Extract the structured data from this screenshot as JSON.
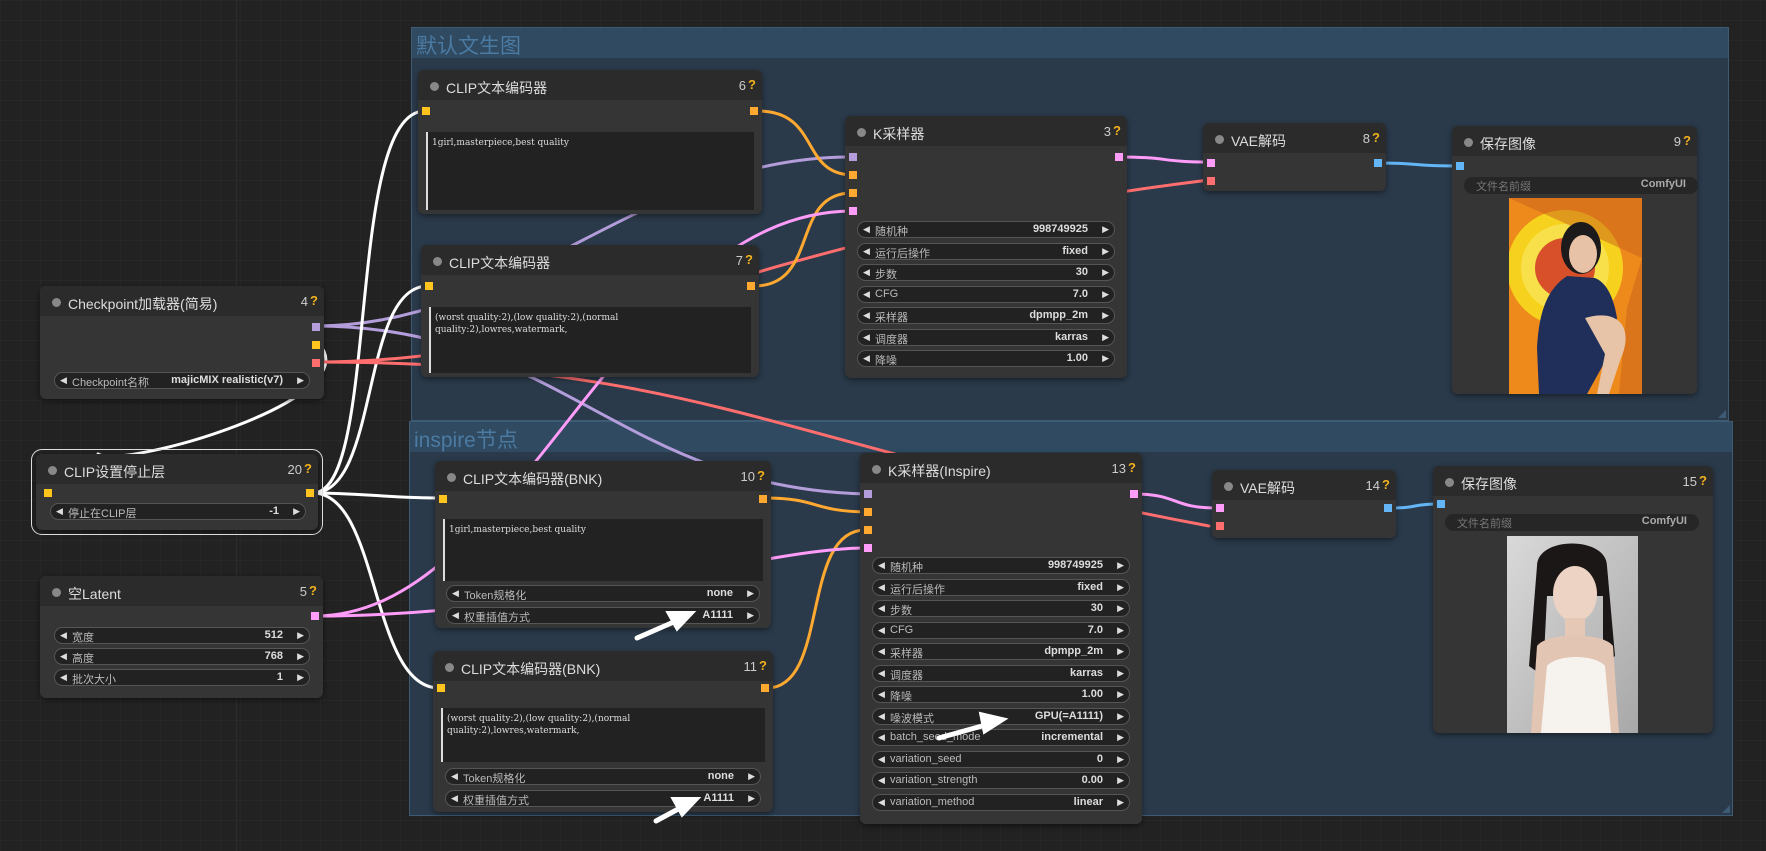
{
  "groups": {
    "default": {
      "title": "默认文生图"
    },
    "inspire": {
      "title": "inspire节点"
    }
  },
  "colors": {
    "model": "#b39ddb",
    "clip": "#ffc51e",
    "vae": "#ff6e6e",
    "conditioning": "#ffa931",
    "latent": "#ff9cf9",
    "image": "#64b5f6"
  },
  "nodes": {
    "ckpt": {
      "title": "Checkpoint加载器(简易)",
      "id": "4",
      "widgets": [
        {
          "label": "Checkpoint名称",
          "value": "majicMIX realistic(v7)"
        }
      ]
    },
    "clipstop": {
      "title": "CLIP设置停止层",
      "id": "20",
      "widgets": [
        {
          "label": "停止在CLIP层",
          "value": "-1"
        }
      ]
    },
    "latent": {
      "title": "空Latent",
      "id": "5",
      "widgets": [
        {
          "label": "宽度",
          "value": "512"
        },
        {
          "label": "高度",
          "value": "768"
        },
        {
          "label": "批次大小",
          "value": "1"
        }
      ]
    },
    "clip6": {
      "title": "CLIP文本编码器",
      "id": "6",
      "text": "1girl,masterpiece,best quality"
    },
    "clip7": {
      "title": "CLIP文本编码器",
      "id": "7",
      "text": "(worst quality:2),(low quality:2),(normal\nquality:2),lowres,watermark,"
    },
    "ksampler": {
      "title": "K采样器",
      "id": "3",
      "widgets": [
        {
          "label": "随机种",
          "value": "998749925"
        },
        {
          "label": "运行后操作",
          "value": "fixed"
        },
        {
          "label": "步数",
          "value": "30"
        },
        {
          "label": "CFG",
          "value": "7.0"
        },
        {
          "label": "采样器",
          "value": "dpmpp_2m"
        },
        {
          "label": "调度器",
          "value": "karras"
        },
        {
          "label": "降噪",
          "value": "1.00"
        }
      ]
    },
    "vae8": {
      "title": "VAE解码",
      "id": "8"
    },
    "save9": {
      "title": "保存图像",
      "id": "9",
      "prefix_label": "文件名前缀",
      "prefix_value": "ComfyUI"
    },
    "bnk10": {
      "title": "CLIP文本编码器(BNK)",
      "id": "10",
      "text": "1girl,masterpiece,best quality",
      "widgets": [
        {
          "label": "Token规格化",
          "value": "none"
        },
        {
          "label": "权重插值方式",
          "value": "A1111"
        }
      ]
    },
    "bnk11": {
      "title": "CLIP文本编码器(BNK)",
      "id": "11",
      "text": "(worst quality:2),(low quality:2),(normal\nquality:2),lowres,watermark,",
      "widgets": [
        {
          "label": "Token规格化",
          "value": "none"
        },
        {
          "label": "权重插值方式",
          "value": "A1111"
        }
      ]
    },
    "ksinspire": {
      "title": "K采样器(Inspire)",
      "id": "13",
      "widgets": [
        {
          "label": "随机种",
          "value": "998749925"
        },
        {
          "label": "运行后操作",
          "value": "fixed"
        },
        {
          "label": "步数",
          "value": "30"
        },
        {
          "label": "CFG",
          "value": "7.0"
        },
        {
          "label": "采样器",
          "value": "dpmpp_2m"
        },
        {
          "label": "调度器",
          "value": "karras"
        },
        {
          "label": "降噪",
          "value": "1.00"
        },
        {
          "label": "噪波模式",
          "value": "GPU(=A1111)"
        },
        {
          "label": "batch_seed_mode",
          "value": "incremental"
        },
        {
          "label": "variation_seed",
          "value": "0"
        },
        {
          "label": "variation_strength",
          "value": "0.00"
        },
        {
          "label": "variation_method",
          "value": "linear"
        }
      ]
    },
    "vae14": {
      "title": "VAE解码",
      "id": "14"
    },
    "save15": {
      "title": "保存图像",
      "id": "15",
      "prefix_label": "文件名前缀",
      "prefix_value": "ComfyUI"
    }
  },
  "icons": {
    "help": "?",
    "left_arrow": "◀",
    "right_arrow": "▶"
  }
}
